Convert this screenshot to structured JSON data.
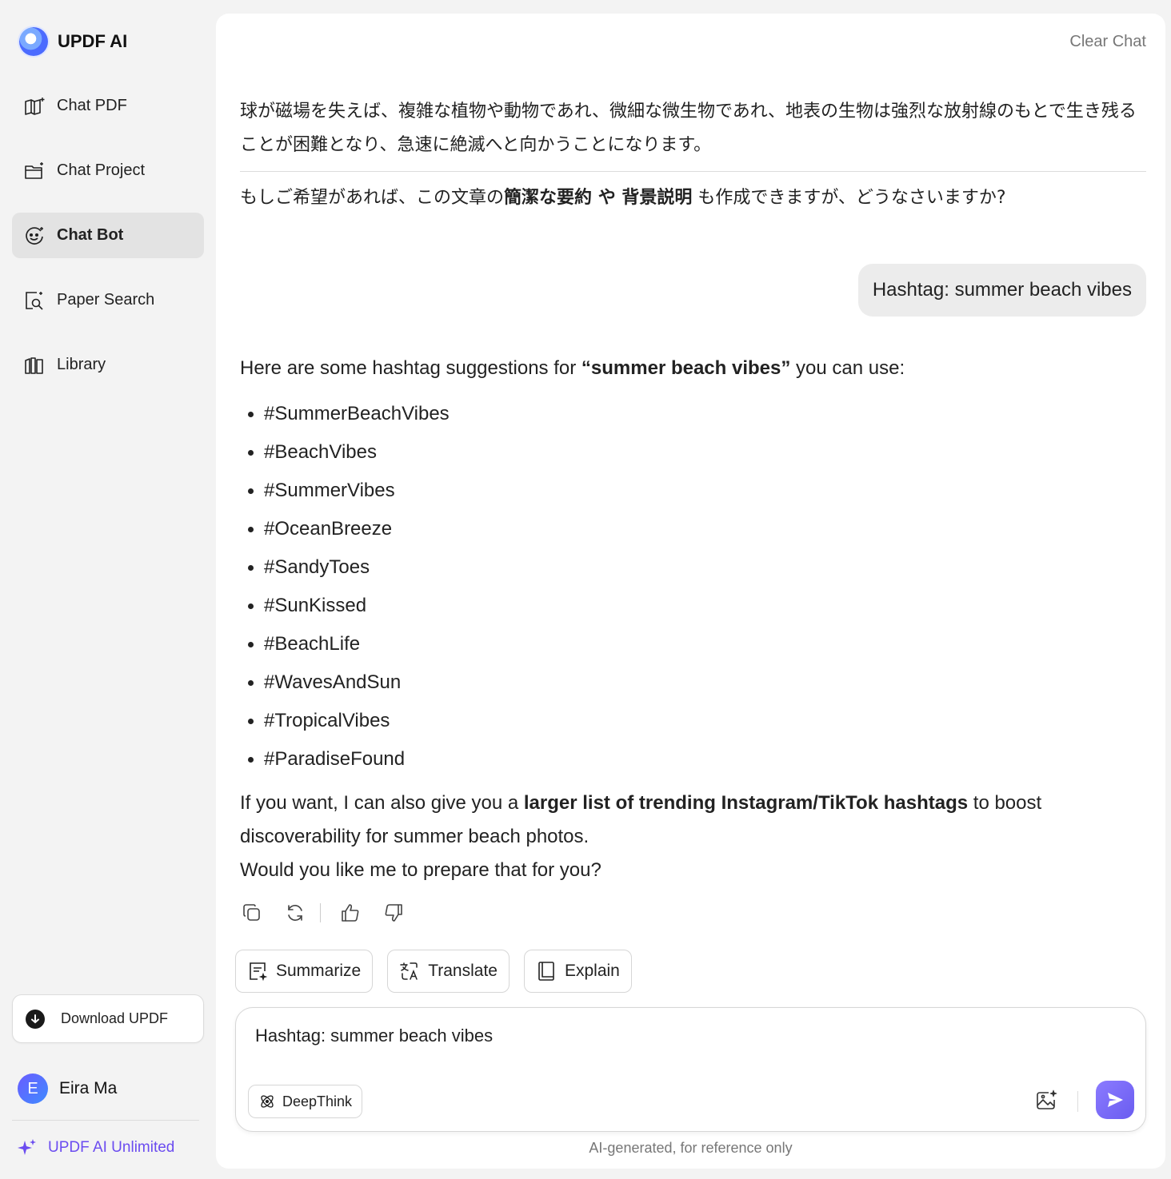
{
  "sidebar": {
    "brand": "UPDF AI",
    "items": [
      {
        "label": "Chat PDF",
        "icon": "book-sparkle-icon"
      },
      {
        "label": "Chat Project",
        "icon": "folder-sparkle-icon"
      },
      {
        "label": "Chat Bot",
        "icon": "bot-face-icon",
        "active": true
      },
      {
        "label": "Paper Search",
        "icon": "document-search-icon"
      },
      {
        "label": "Library",
        "icon": "library-books-icon"
      }
    ],
    "download_label": "Download UPDF",
    "user": {
      "initial": "E",
      "name": "Eira Ma"
    },
    "unlimited_label": "UPDF AI Unlimited"
  },
  "main": {
    "clear_chat": "Clear Chat",
    "jp_paragraph": "球が磁場を失えば、複雑な植物や動物であれ、微細な微生物であれ、地表の生物は強烈な放射線のもとで生き残ることが困難となり、急速に絶滅へと向かうことになります。",
    "jp_question": {
      "pre": "もしご希望があれば、この文章の",
      "bold1": "簡潔な要約",
      "mid": " や ",
      "bold2": "背景説明",
      "post": " も作成できますが、どうなさいますか?"
    },
    "user_message": "Hashtag: summer beach vibes",
    "ai_intro": {
      "pre": "Here are some hashtag suggestions for ",
      "bold": "“summer beach vibes”",
      "post": " you can use:"
    },
    "hashtags": [
      "#SummerBeachVibes",
      "#BeachVibes",
      "#SummerVibes",
      "#OceanBreeze",
      "#SandyToes",
      "#SunKissed",
      "#BeachLife",
      "#WavesAndSun",
      "#TropicalVibes",
      "#ParadiseFound"
    ],
    "ai_outro": {
      "pre": "If you want, I can also give you a ",
      "bold": "larger list of trending Instagram/TikTok hashtags",
      "post": " to boost discoverability for summer beach photos.",
      "line2": "Would you like me to prepare that for you?"
    },
    "chips": [
      "Summarize",
      "Translate",
      "Explain"
    ],
    "composer": {
      "value": "Hashtag: summer beach vibes",
      "deepthink_label": "DeepThink"
    },
    "footnote": "AI-generated, for reference only"
  },
  "colors": {
    "accent": "#6b4cf0",
    "active_bg": "#e3e3e3",
    "panel_bg": "#ffffff",
    "page_bg": "#f3f3f3"
  }
}
